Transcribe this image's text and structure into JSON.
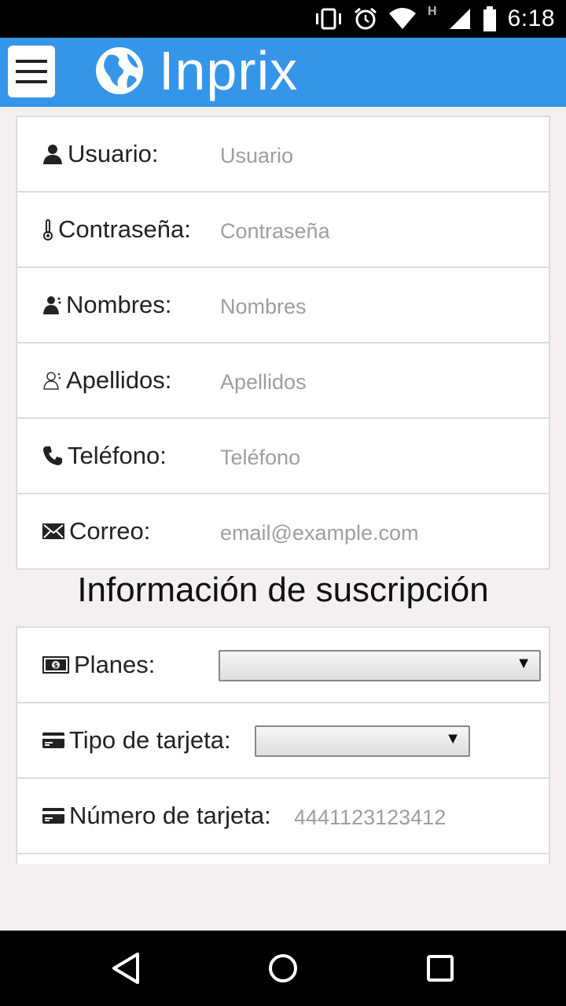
{
  "status_bar": {
    "time": "6:18",
    "network_letter": "H",
    "icons": [
      "vibrate-icon",
      "alarm-icon",
      "wifi-icon",
      "signal-icon",
      "battery-icon"
    ]
  },
  "app_bar": {
    "brand": "Inprix",
    "menu_icon": "hamburger-menu-icon",
    "logo_icon": "globe-icon",
    "color": "#3595e8"
  },
  "account_form": {
    "fields": [
      {
        "label": "Usuario:",
        "placeholder": "Usuario",
        "icon": "user-icon"
      },
      {
        "label": "Contraseña:",
        "placeholder": "Contraseña",
        "icon": "thermometer-icon"
      },
      {
        "label": "Nombres:",
        "placeholder": "Nombres",
        "icon": "user-tie-icon"
      },
      {
        "label": "Apellidos:",
        "placeholder": "Apellidos",
        "icon": "user-outline-icon"
      },
      {
        "label": "Teléfono:",
        "placeholder": "Teléfono",
        "icon": "phone-icon"
      },
      {
        "label": "Correo:",
        "placeholder": "email@example.com",
        "icon": "envelope-icon"
      }
    ]
  },
  "subscription": {
    "title": "Información de suscripción",
    "plans": {
      "label": "Planes:",
      "icon": "money-icon",
      "selected": "",
      "arrow": "▼"
    },
    "card_type": {
      "label": "Tipo de tarjeta:",
      "icon": "credit-card-icon",
      "selected": "",
      "arrow": "▼"
    },
    "card_number": {
      "label": "Número de tarjeta:",
      "placeholder": "4441123123412",
      "icon": "credit-card-icon"
    }
  },
  "nav_bar": {
    "buttons": [
      "back-icon",
      "home-icon",
      "recents-icon"
    ]
  }
}
